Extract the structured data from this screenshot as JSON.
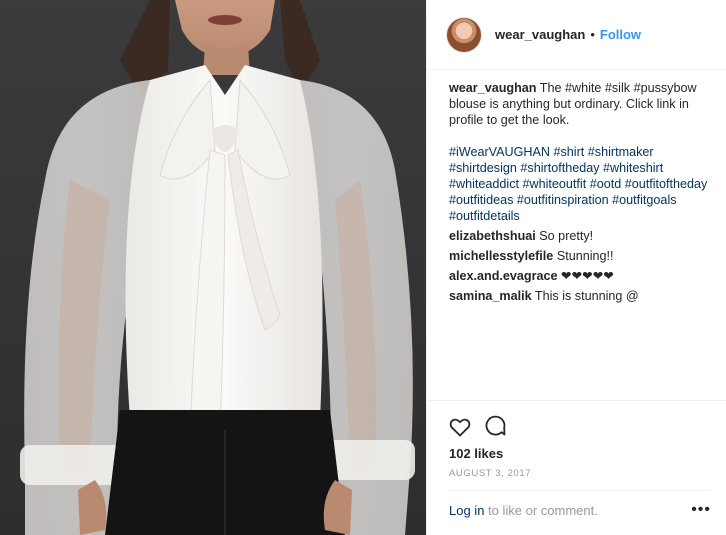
{
  "post": {
    "image_alt": "woman wearing white silk pussybow blouse",
    "author": {
      "username": "wear_vaughan",
      "separator": "•",
      "follow_label": "Follow"
    },
    "caption": {
      "username": "wear_vaughan",
      "line1_text": "The #white #silk #pussybow blouse is anything but ordinary. Click link in profile to get the look.",
      "line2_text": "#iWearVAUGHAN #shirt #shirtmaker #shirtdesign #shirtoftheday #whiteshirt #whiteaddict #whiteoutfit #ootd #outfitoftheday #outfitideas #outfitinspiration #outfitgoals #outfitdetails"
    },
    "comments": [
      {
        "username": "elizabethshuai",
        "text": "So pretty!"
      },
      {
        "username": "michellesstylefile",
        "text": "Stunning!!"
      },
      {
        "username": "alex.and.evagrace",
        "text": "❤❤❤❤❤"
      },
      {
        "username": "samina_malik",
        "text": "This is stunning @"
      }
    ],
    "likes_text": "102 likes",
    "date": "AUGUST 3, 2017",
    "login_link": "Log in",
    "login_suffix": " to like or comment.",
    "more_label": "•••",
    "icons": {
      "like": "heart-icon",
      "comment": "comment-icon",
      "more": "more-options-icon"
    }
  }
}
